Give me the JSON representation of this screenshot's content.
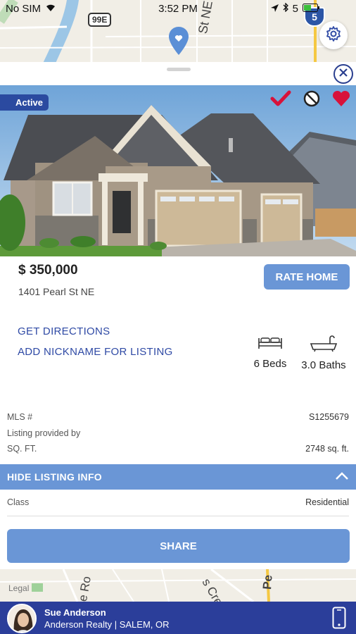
{
  "status": {
    "carrier": "No SIM",
    "time": "3:52 PM",
    "battery": "5"
  },
  "map": {
    "labels": {
      "hwy_99e": "99E",
      "hwy_5": "5",
      "street_top": "St NE",
      "legal": "Legal",
      "street_bottom_a": "e Ro",
      "street_bottom_b": "s Cre",
      "street_bottom_c": "Pe"
    }
  },
  "listing": {
    "status_badge": "Active",
    "price": "$ 350,000",
    "address": "1401 Pearl St NE",
    "rate_button": "RATE HOME",
    "get_directions": "GET DIRECTIONS",
    "add_nickname": "ADD NICKNAME FOR LISTING",
    "beds": "6 Beds",
    "baths": "3.0 Baths",
    "info": {
      "mls_label": "MLS #",
      "mls_value": "S1255679",
      "provided_label": "Listing provided by",
      "sqft_label": "SQ. FT.",
      "sqft_value": "2748 sq. ft."
    },
    "hide_listing_info": "HIDE LISTING INFO",
    "class_label": "Class",
    "class_value": "Residential",
    "share_button": "SHARE"
  },
  "agent": {
    "name": "Sue Anderson",
    "company": "Anderson Realty | SALEM, OR"
  },
  "colors": {
    "accent": "#6a96d6",
    "brand": "#2b3e9a",
    "badge": "#2b4aa0",
    "heart": "#d8123a"
  }
}
